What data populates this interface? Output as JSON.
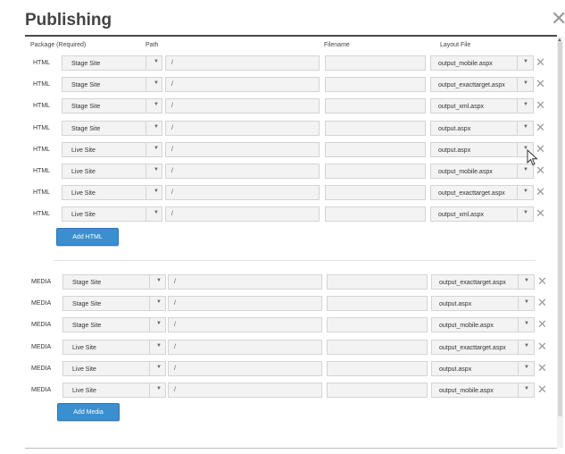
{
  "dialog": {
    "title": "Publishing",
    "close_glyph": "✕"
  },
  "columns": {
    "package": "Package (Required)",
    "path": "Path",
    "filename": "Filename",
    "layout": "Layout File"
  },
  "html_rows": [
    {
      "type": "HTML",
      "site": "Stage Site",
      "path": "/",
      "filename": "",
      "layout": "output_mobile.aspx"
    },
    {
      "type": "HTML",
      "site": "Stage Site",
      "path": "/",
      "filename": "",
      "layout": "output_exacttarget.aspx"
    },
    {
      "type": "HTML",
      "site": "Stage Site",
      "path": "/",
      "filename": "",
      "layout": "output_xml.aspx"
    },
    {
      "type": "HTML",
      "site": "Stage Site",
      "path": "/",
      "filename": "",
      "layout": "output.aspx"
    },
    {
      "type": "HTML",
      "site": "Live Site",
      "path": "/",
      "filename": "",
      "layout": "output.aspx"
    },
    {
      "type": "HTML",
      "site": "Live Site",
      "path": "/",
      "filename": "",
      "layout": "output_mobile.aspx"
    },
    {
      "type": "HTML",
      "site": "Live Site",
      "path": "/",
      "filename": "",
      "layout": "output_exacttarget.aspx"
    },
    {
      "type": "HTML",
      "site": "Live Site",
      "path": "/",
      "filename": "",
      "layout": "output_xml.aspx"
    }
  ],
  "media_rows": [
    {
      "type": "MEDIA",
      "site": "Stage Site",
      "path": "/",
      "filename": "",
      "layout": "output_exacttarget.aspx"
    },
    {
      "type": "MEDIA",
      "site": "Stage Site",
      "path": "/",
      "filename": "",
      "layout": "output.aspx"
    },
    {
      "type": "MEDIA",
      "site": "Stage Site",
      "path": "/",
      "filename": "",
      "layout": "output_mobile.aspx"
    },
    {
      "type": "MEDIA",
      "site": "Live Site",
      "path": "/",
      "filename": "",
      "layout": "output_exacttarget.aspx"
    },
    {
      "type": "MEDIA",
      "site": "Live Site",
      "path": "/",
      "filename": "",
      "layout": "output.aspx"
    },
    {
      "type": "MEDIA",
      "site": "Live Site",
      "path": "/",
      "filename": "",
      "layout": "output_mobile.aspx"
    }
  ],
  "buttons": {
    "add_html": "Add HTML",
    "add_media": "Add Media"
  },
  "glyphs": {
    "caret": "▼",
    "delete": "✕",
    "scroll_up": "▲"
  },
  "colors": {
    "accent": "#3a8fd0",
    "field_bg": "#f3f3f3",
    "border": "#d4d4d4"
  }
}
